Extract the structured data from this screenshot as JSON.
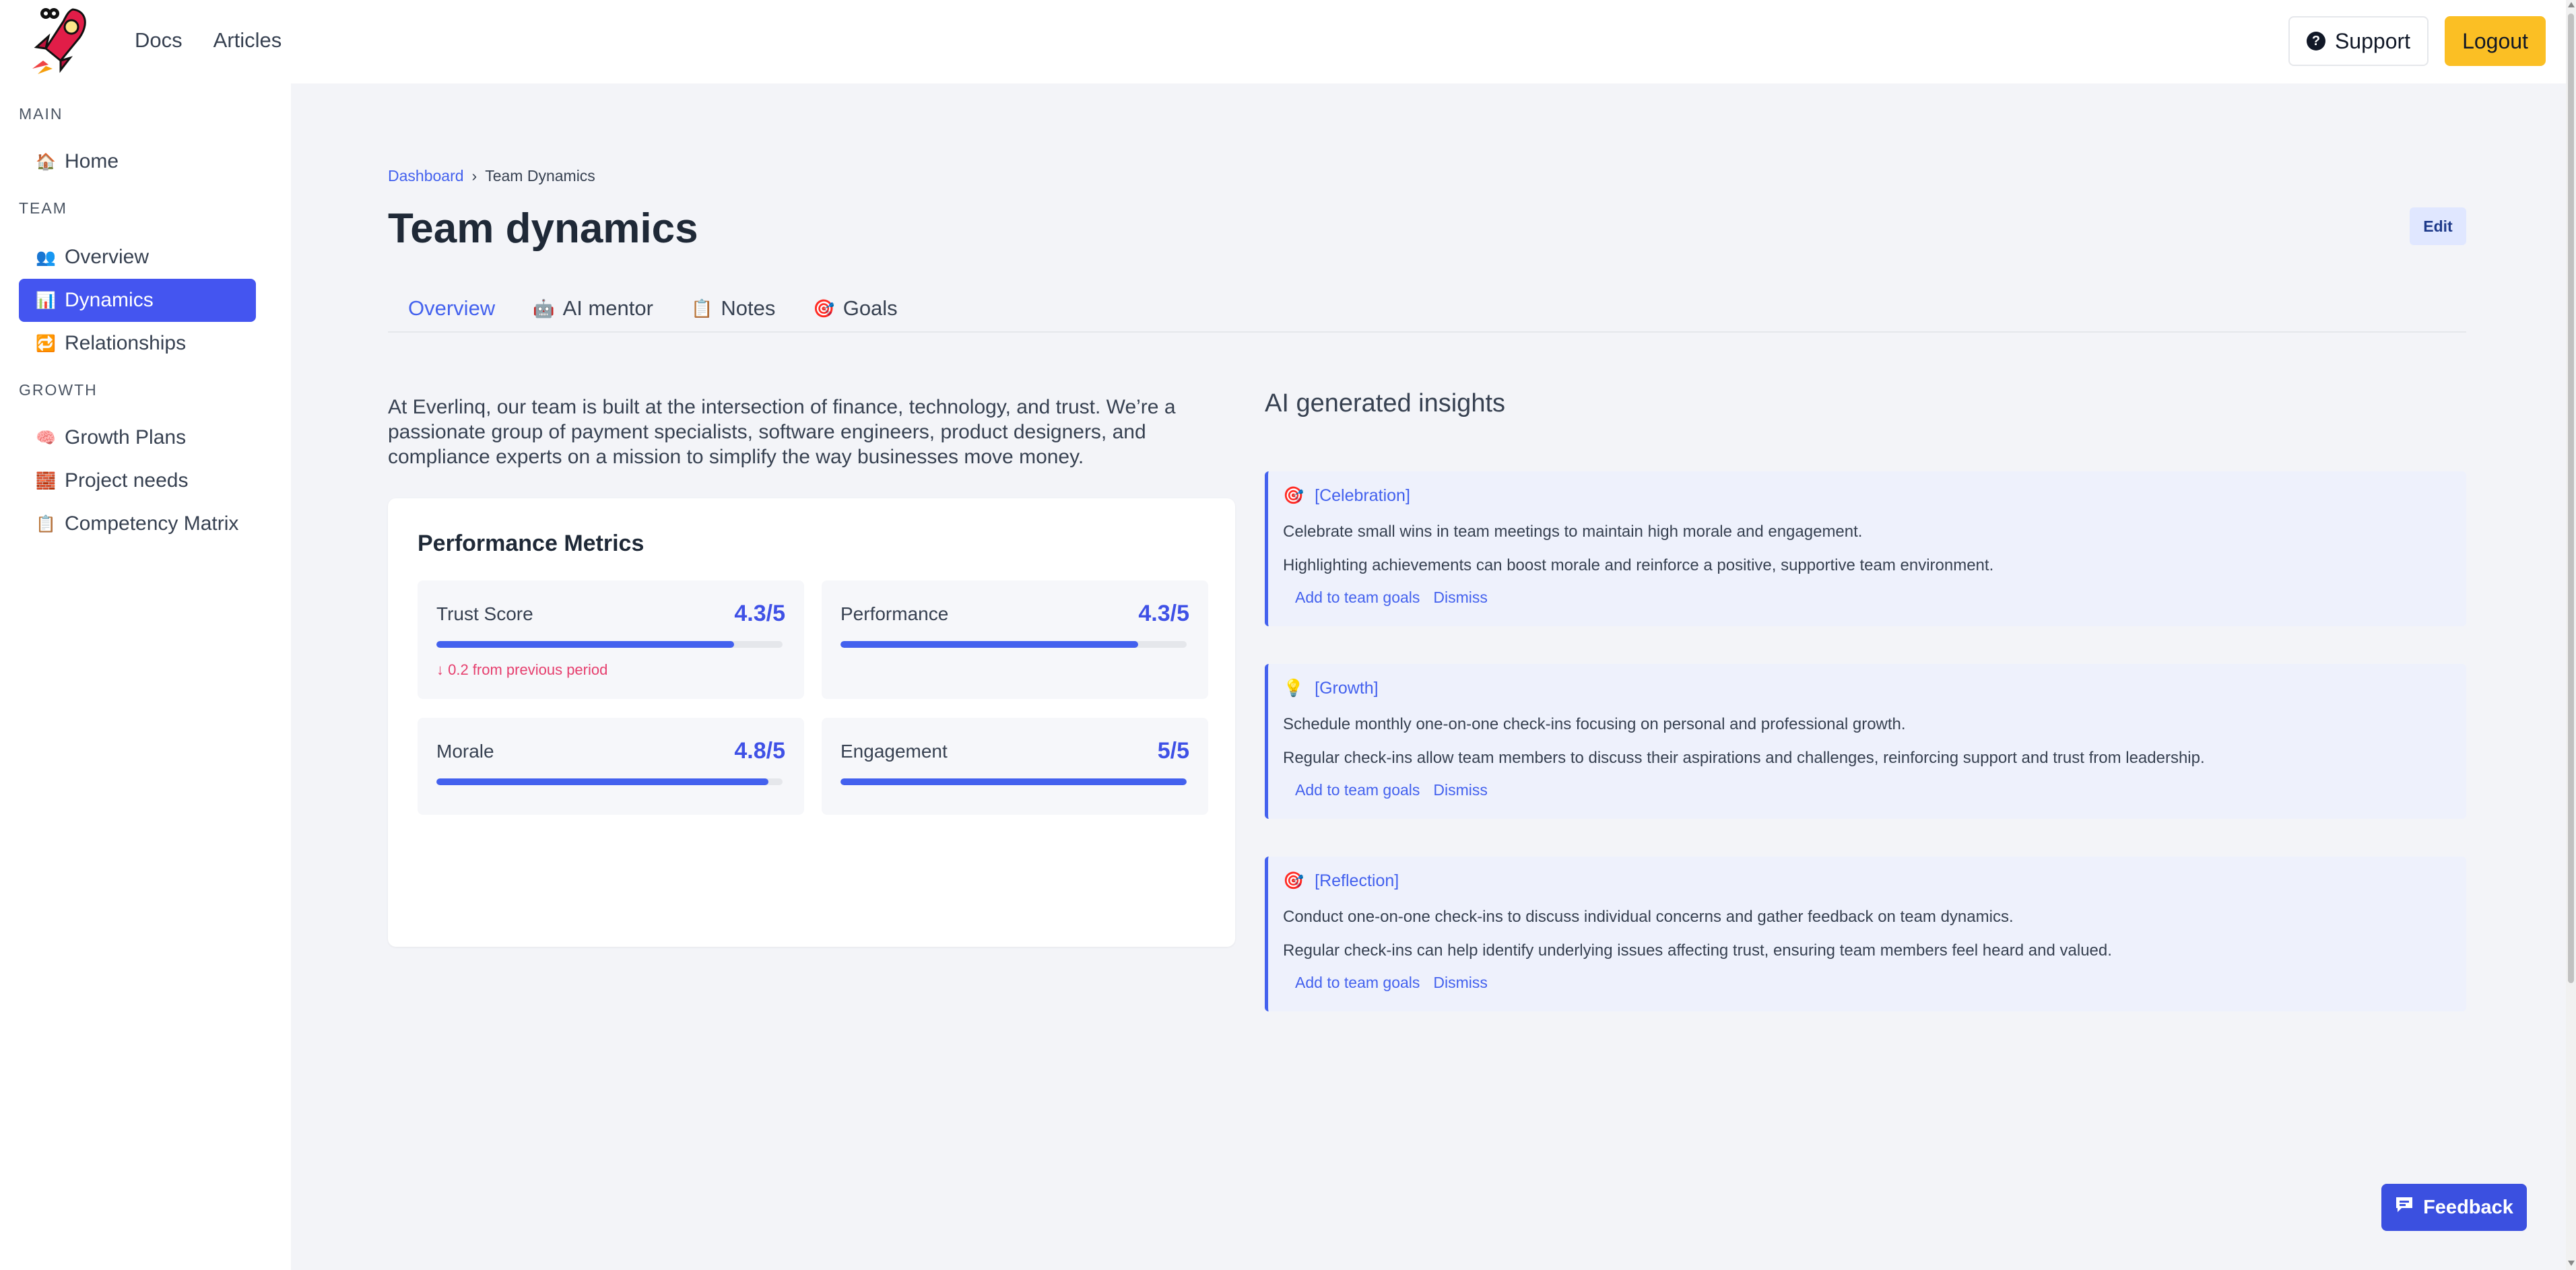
{
  "topnav": {
    "docs": "Docs",
    "articles": "Articles",
    "support": "Support",
    "logout": "Logout"
  },
  "sidebar": {
    "sections": {
      "main": "MAIN",
      "team": "TEAM",
      "growth": "GROWTH"
    },
    "items": [
      {
        "label": "Home",
        "icon": "home-icon"
      },
      {
        "label": "Overview",
        "icon": "people-icon"
      },
      {
        "label": "Dynamics",
        "icon": "bar-chart-icon",
        "active": true
      },
      {
        "label": "Relationships",
        "icon": "relationships-icon"
      },
      {
        "label": "Growth Plans",
        "icon": "brain-icon"
      },
      {
        "label": "Project needs",
        "icon": "bricks-icon"
      },
      {
        "label": "Competency Matrix",
        "icon": "clipboard-icon"
      }
    ]
  },
  "breadcrumb": {
    "parent": "Dashboard",
    "separator": "›",
    "current": "Team Dynamics"
  },
  "page": {
    "title": "Team dynamics",
    "edit": "Edit"
  },
  "tabs": [
    {
      "label": "Overview",
      "icon": ""
    },
    {
      "label": "AI mentor",
      "icon": "robot-icon"
    },
    {
      "label": "Notes",
      "icon": "clipboard-icon"
    },
    {
      "label": "Goals",
      "icon": "target-icon"
    }
  ],
  "intro": "At Everlinq, our team is built at the intersection of finance, technology, and trust. We’re a passionate group of payment specialists, software engineers, product designers, and compliance experts on a mission to simplify the way businesses move money.",
  "metrics": {
    "title": "Performance Metrics",
    "items": [
      {
        "name": "Trust Score",
        "value": "4.3/5",
        "fraction": 0.86,
        "delta": "↓ 0.2 from previous period"
      },
      {
        "name": "Performance",
        "value": "4.3/5",
        "fraction": 0.86
      },
      {
        "name": "Morale",
        "value": "4.8/5",
        "fraction": 0.96
      },
      {
        "name": "Engagement",
        "value": "5/5",
        "fraction": 1.0
      }
    ]
  },
  "insights": {
    "title": "AI generated insights",
    "items": [
      {
        "tag": "[Celebration]",
        "icon": "target-icon",
        "line1": "Celebrate small wins in team meetings to maintain high morale and engagement.",
        "line2": "Highlighting achievements can boost morale and reinforce a positive, supportive team environment.",
        "add": "Add to team goals",
        "dismiss": "Dismiss"
      },
      {
        "tag": "[Growth]",
        "icon": "lightbulb-icon",
        "line1": "Schedule monthly one-on-one check-ins focusing on personal and professional growth.",
        "line2": "Regular check-ins allow team members to discuss their aspirations and challenges, reinforcing support and trust from leadership.",
        "add": "Add to team goals",
        "dismiss": "Dismiss"
      },
      {
        "tag": "[Reflection]",
        "icon": "target-icon",
        "line1": "Conduct one-on-one check-ins to discuss individual concerns and gather feedback on team dynamics.",
        "line2": "Regular check-ins can help identify underlying issues affecting trust, ensuring team members feel heard and valued.",
        "add": "Add to team goals",
        "dismiss": "Dismiss"
      }
    ]
  },
  "feedback": "Feedback",
  "colors": {
    "accent": "#4361ee",
    "active_nav": "#4455f0",
    "logout": "#fbbf24",
    "negative": "#e63e6d"
  }
}
